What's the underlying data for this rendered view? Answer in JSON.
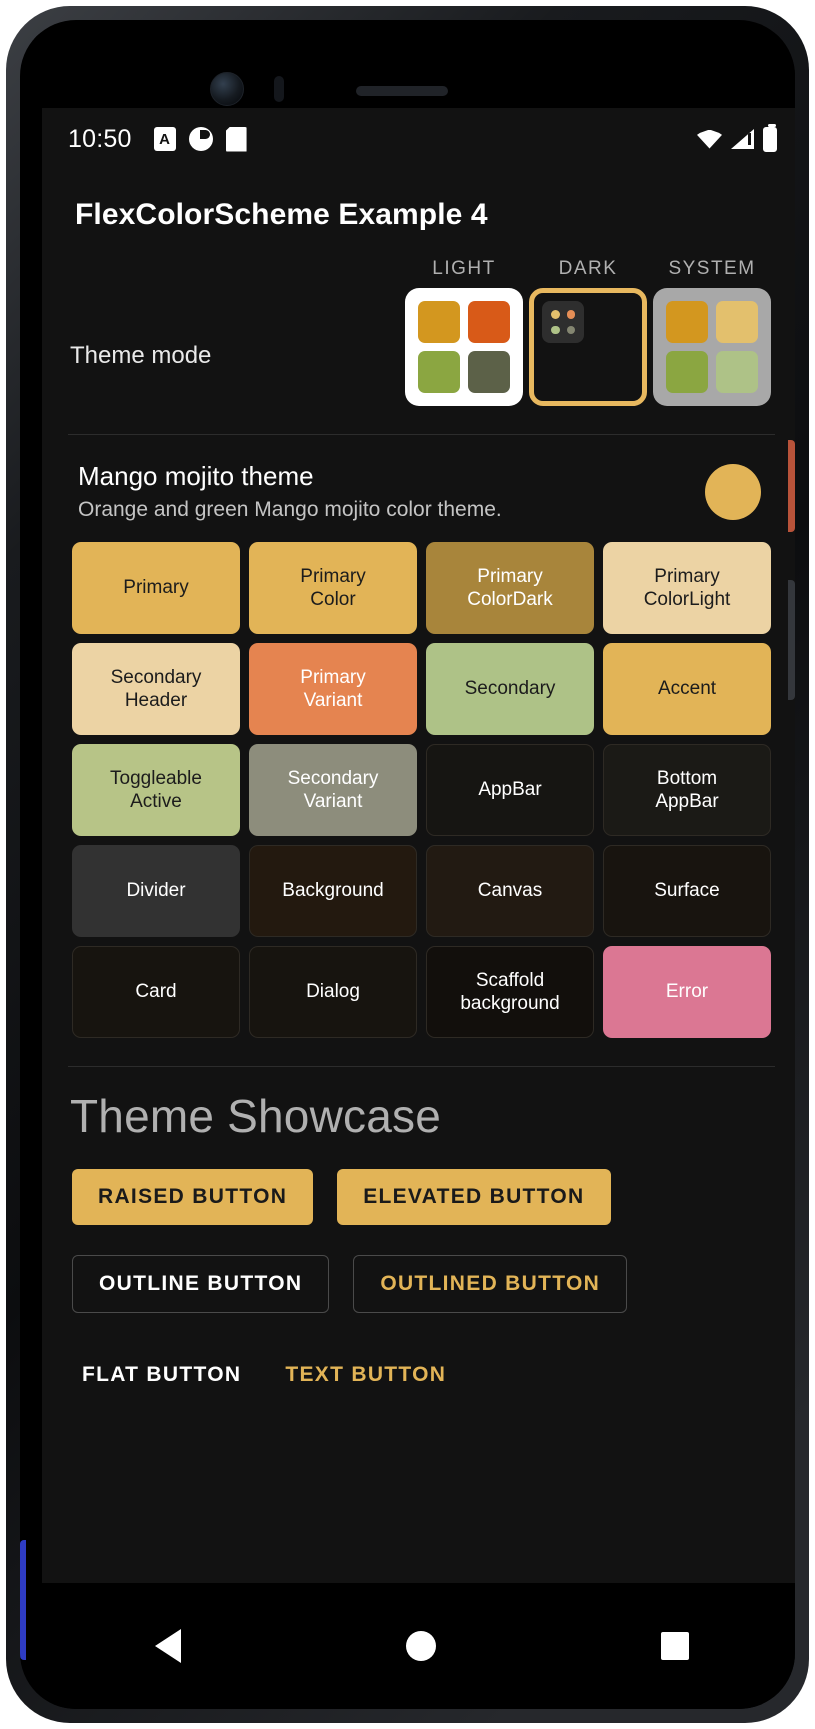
{
  "status_bar": {
    "clock": "10:50",
    "left_icons": [
      "a-badge-icon",
      "do-not-disturb-icon",
      "sd-card-icon"
    ],
    "right_icons": [
      "wifi-icon",
      "cellular-signal-icon",
      "battery-icon"
    ]
  },
  "app_bar": {
    "title": "FlexColorScheme Example 4"
  },
  "theme_mode": {
    "label": "Theme mode",
    "selected": "DARK",
    "options": [
      {
        "caption": "LIGHT",
        "box_bg": "#ffffff",
        "selected": false,
        "swatches": [
          "#d3971f",
          "#d85a18",
          "#8ba641",
          "#5c6148"
        ]
      },
      {
        "caption": "DARK",
        "box_bg": "#2e2e2e",
        "border": "#e8b85f",
        "selected": true,
        "swatches": [
          "#e3c06d",
          "#e58e56",
          "#aec287",
          "#848671"
        ]
      },
      {
        "caption": "SYSTEM",
        "box_bg": "#a8a8a8",
        "selected": false,
        "swatches": [
          "#d3971f",
          "#e3c06d",
          "#8ba641",
          "#aec287"
        ]
      }
    ]
  },
  "theme_card": {
    "title": "Mango mojito theme",
    "subtitle": "Orange and green Mango mojito color theme.",
    "avatar_color": "#e2b457"
  },
  "color_grid": [
    {
      "label": "Primary",
      "bg": "#e2b457",
      "fg": "#1c1c1c"
    },
    {
      "label": "Primary\nColor",
      "bg": "#e2b457",
      "fg": "#1c1c1c"
    },
    {
      "label": "Primary\nColorDark",
      "bg": "#a8853b",
      "fg": "#ffffff"
    },
    {
      "label": "Primary\nColorLight",
      "bg": "#ecd3a4",
      "fg": "#1c1c1c"
    },
    {
      "label": "Secondary\nHeader",
      "bg": "#ecd3a4",
      "fg": "#1c1c1c"
    },
    {
      "label": "Primary\nVariant",
      "bg": "#e58450",
      "fg": "#ffffff"
    },
    {
      "label": "Secondary",
      "bg": "#aec287",
      "fg": "#1c1c1c"
    },
    {
      "label": "Accent",
      "bg": "#e2b457",
      "fg": "#1c1c1c"
    },
    {
      "label": "Toggleable\nActive",
      "bg": "#b7c487",
      "fg": "#1c1c1c"
    },
    {
      "label": "Secondary\nVariant",
      "bg": "#8d8d7c",
      "fg": "#ffffff"
    },
    {
      "label": "AppBar",
      "bg": "#161512",
      "fg": "#ffffff"
    },
    {
      "label": "Bottom\nAppBar",
      "bg": "#1b1a16",
      "fg": "#ffffff"
    },
    {
      "label": "Divider",
      "bg": "#323232",
      "fg": "#ffffff"
    },
    {
      "label": "Background",
      "bg": "#23190f",
      "fg": "#ffffff"
    },
    {
      "label": "Canvas",
      "bg": "#221a12",
      "fg": "#ffffff"
    },
    {
      "label": "Surface",
      "bg": "#18140f",
      "fg": "#ffffff"
    },
    {
      "label": "Card",
      "bg": "#17140f",
      "fg": "#ffffff"
    },
    {
      "label": "Dialog",
      "bg": "#17140f",
      "fg": "#ffffff"
    },
    {
      "label": "Scaffold\nbackground",
      "bg": "#120f0c",
      "fg": "#ffffff"
    },
    {
      "label": "Error",
      "bg": "#db7793",
      "fg": "#ffffff"
    }
  ],
  "showcase": {
    "title": "Theme Showcase",
    "buttons": {
      "raised": "RAISED BUTTON",
      "elevated": "ELEVATED BUTTON",
      "outline": "OUTLINE BUTTON",
      "outlined": "OUTLINED BUTTON",
      "flat": "FLAT BUTTON",
      "text": "TEXT BUTTON"
    },
    "accent_color": "#e2b457"
  },
  "nav_bar": {
    "items": [
      "back-icon",
      "home-icon",
      "recents-icon"
    ]
  }
}
